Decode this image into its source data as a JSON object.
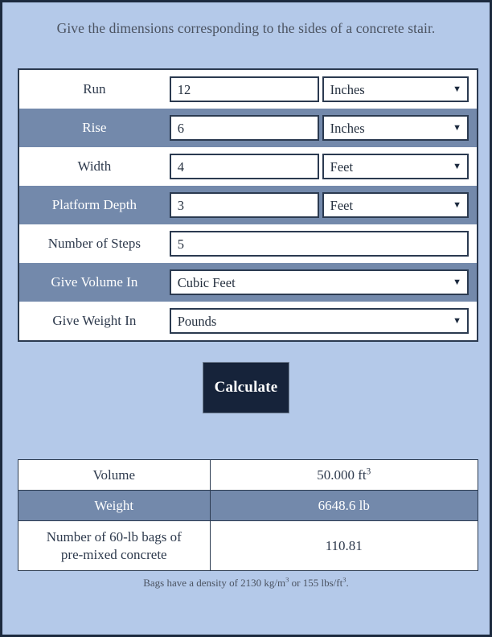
{
  "page": {
    "prompt": "Give the dimensions corresponding to the sides of a concrete stair.",
    "bg_color": "#b4c9e9",
    "stripe_color": "#7389ab",
    "border_color": "#1c2a3e"
  },
  "form": {
    "rows": [
      {
        "label": "Run",
        "value": "12",
        "unit": "Inches",
        "has_unit": true
      },
      {
        "label": "Rise",
        "value": "6",
        "unit": "Inches",
        "has_unit": true
      },
      {
        "label": "Width",
        "value": "4",
        "unit": "Feet",
        "has_unit": true
      },
      {
        "label": "Platform Depth",
        "value": "3",
        "unit": "Feet",
        "has_unit": true
      },
      {
        "label": "Number of Steps",
        "value": "5",
        "unit": "",
        "has_unit": false
      },
      {
        "label": "Give Volume In",
        "value": "Cubic Feet",
        "unit": "",
        "has_unit": false
      },
      {
        "label": "Give Weight In",
        "value": "Pounds",
        "unit": "",
        "has_unit": false
      }
    ],
    "caret_glyph": "▼"
  },
  "actions": {
    "calculate_label": "Calculate"
  },
  "results": {
    "rows": [
      {
        "label": "Volume",
        "label_line2": "",
        "value_text": "50.000 ft",
        "value_sup": "3"
      },
      {
        "label": "Weight",
        "label_line2": "",
        "value_text": "6648.6 lb",
        "value_sup": ""
      },
      {
        "label": "Number of 60-lb bags of",
        "label_line2": "pre-mixed concrete",
        "value_text": "110.81",
        "value_sup": ""
      }
    ]
  },
  "footnote": {
    "part1": "Bags have a density of 2130 kg/m",
    "sup1": "3",
    "part2": " or 155 lbs/ft",
    "sup2": "3",
    "part3": "."
  }
}
